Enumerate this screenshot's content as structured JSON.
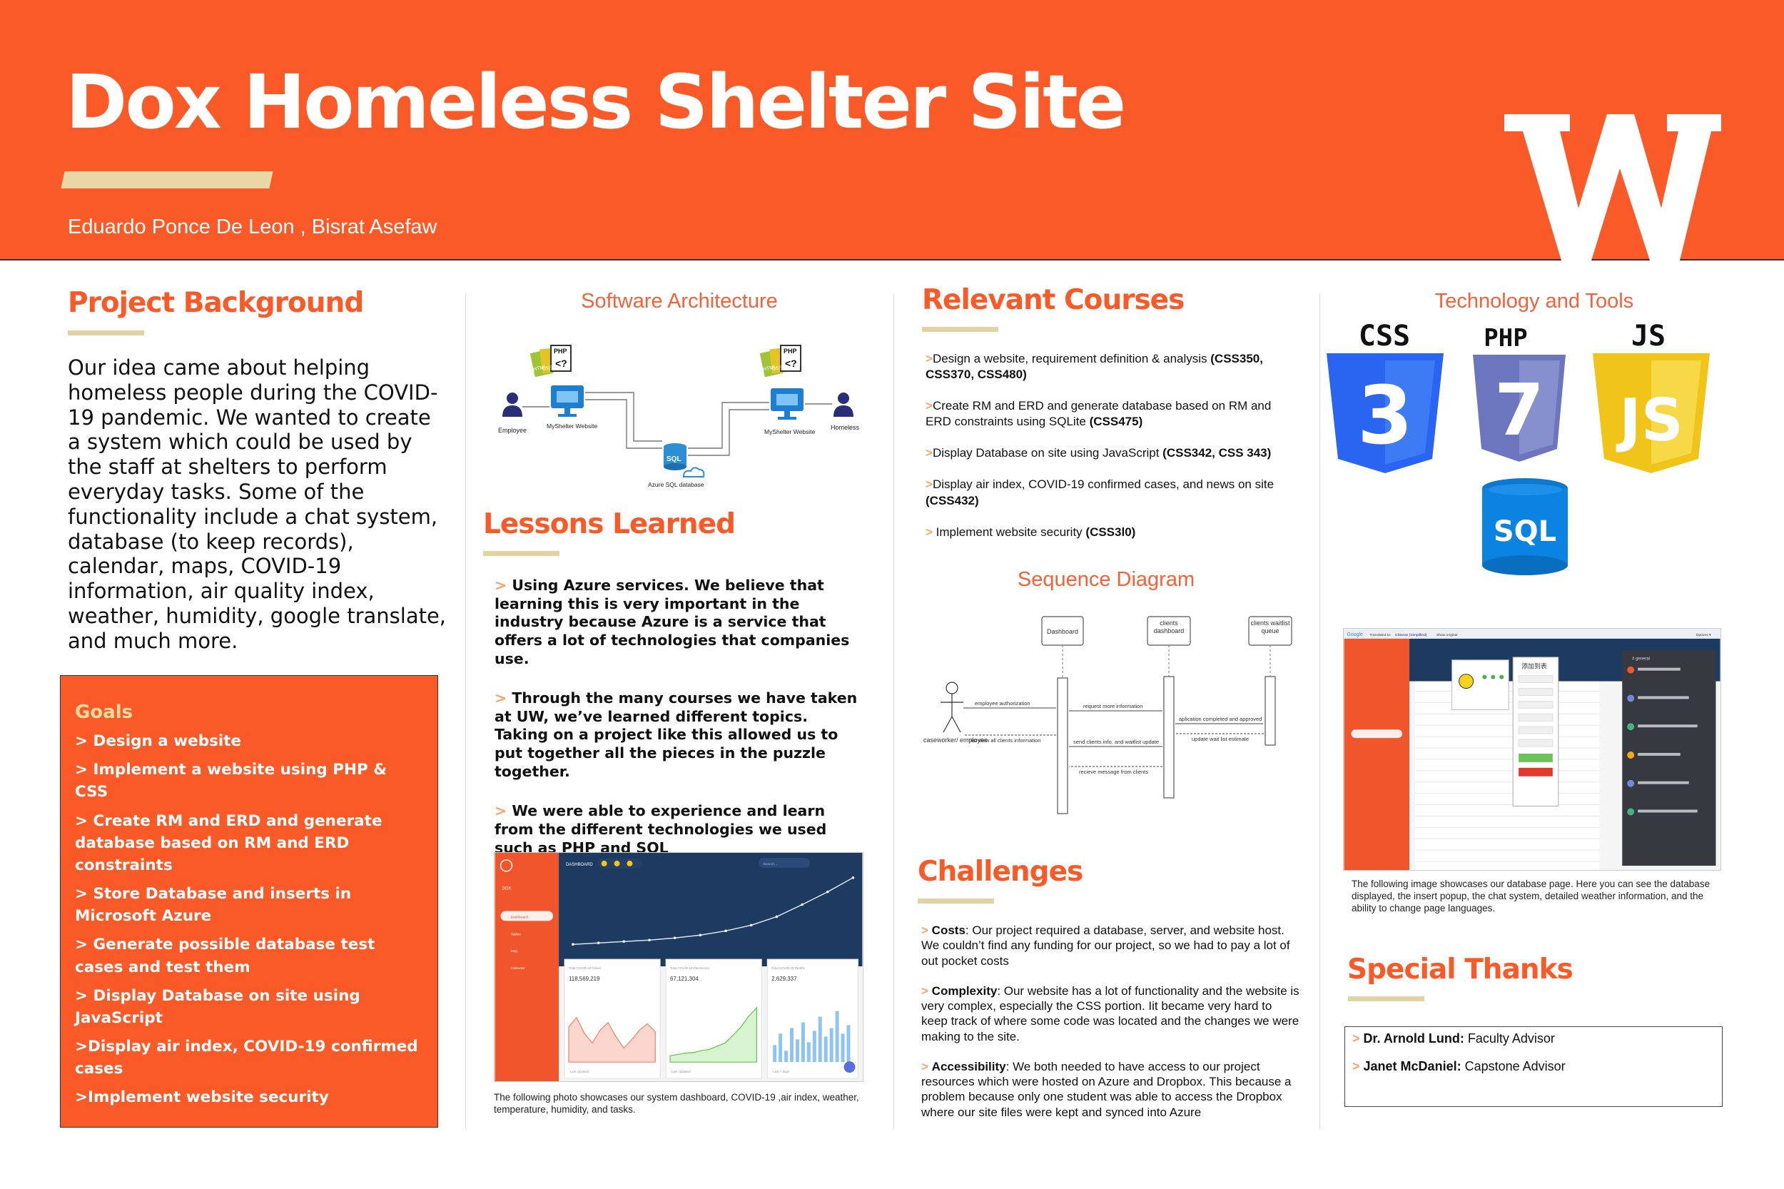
{
  "header": {
    "title": "Dox Homeless Shelter Site",
    "authors": "Eduardo Ponce De Leon , Bisrat Asefaw",
    "logo_letter": "W",
    "bg_color": "#fa5a28",
    "accent_color": "#e9d7a6"
  },
  "background": {
    "title": "Project Background",
    "text": "Our idea came about helping homeless people during the COVID-19 pandemic. We wanted to create a system which could be used by the staff at shelters to perform everyday tasks. Some of the functionality include a chat system, database (to keep records), calendar, maps, COVID-19 information, air quality index, weather, humidity, google translate, and much more."
  },
  "goals": {
    "title": "Goals",
    "items": [
      "> Design a website",
      "> Implement a website using PHP & CSS",
      "> Create RM and ERD and generate database based on RM and ERD constraints",
      "> Store Database and inserts in Microsoft Azure",
      "> Generate possible database test cases and test them",
      "> Display Database on site using JavaScript",
      ">Display air index, COVID-19 confirmed cases",
      ">Implement website security"
    ]
  },
  "architecture": {
    "title": "Software Architecture",
    "file_label": "PHP",
    "file_sub_labels": [
      "HTML",
      "CSS"
    ],
    "file_symbol": "<?",
    "employee": "Employee",
    "site_left": "MyShelter Website",
    "site_right": "MyShelter Website",
    "homeless": "Homeless",
    "db_icon": "SQL",
    "db": "Azure SQL database"
  },
  "lessons": {
    "title": "Lessons Learned",
    "marker": ">",
    "items": [
      "Using Azure services. We believe that learning this is very important in the industry because Azure is a service that offers a lot of technologies that companies use.",
      "Through the many courses we have taken at UW, we’ve learned different topics. Taking on a project like this allowed us to put together all the pieces in the puzzle together.",
      "We were able to experience and learn from the different technologies we used such as PHP and SQL"
    ]
  },
  "dashboard": {
    "caption": "The following photo showcases our system dashboard, COVID-19 ,air index, weather, temperature, humidity, and tasks.",
    "header_label": "DASHBOARD",
    "search_placeholder": "Search...",
    "brand_label": "DOX",
    "nav_items": [
      "Dashboard",
      "Tables",
      "Map",
      "Calendar"
    ],
    "stat_labels": [
      "Total COVID-19 Cases",
      "Total COVID-19 Recoveries",
      "Total COVID-19 Deaths"
    ],
    "stats": [
      "118,569,219",
      "67,121,304",
      "2,629,337"
    ],
    "card_footers": [
      "Last Updated",
      "Last Updated",
      "Last 7 days"
    ],
    "chart_line": [
      0.06,
      0.08,
      0.1,
      0.12,
      0.15,
      0.19,
      0.25,
      0.33,
      0.45,
      0.62,
      0.8,
      1.0
    ],
    "card_red": [
      0.55,
      0.7,
      0.45,
      0.3,
      0.5,
      0.62,
      0.4,
      0.22,
      0.35,
      0.5,
      0.6,
      0.48
    ],
    "card_green": [
      0.1,
      0.12,
      0.14,
      0.15,
      0.18,
      0.2,
      0.25,
      0.3,
      0.42,
      0.55,
      0.72,
      0.85
    ],
    "card_bars": [
      0.3,
      0.5,
      0.2,
      0.6,
      0.4,
      0.7,
      0.35,
      0.55,
      0.8,
      0.45,
      0.6,
      0.9,
      0.5,
      0.65
    ]
  },
  "courses": {
    "title": "Relevant Courses",
    "marker": ">",
    "items": [
      {
        "text": "Design a website, requirement definition & analysis ",
        "code": "(CSS350, CSS370, CSS480)"
      },
      {
        "text": "Create RM and ERD and generate database based on RM and ERD constraints using SQLite ",
        "code": "(CSS475)"
      },
      {
        "text": "Display Database on site using JavaScript ",
        "code": "(CSS342, CSS 343)"
      },
      {
        "text": "Display air index, COVID-19 confirmed cases, and news on site ",
        "code": "(CSS432)"
      },
      {
        "text": " Implement website security ",
        "code": "(CSS3l0)"
      }
    ]
  },
  "sequence": {
    "title": "Sequence Diagram",
    "lifelines": [
      "Dashboard",
      "clients dashboard",
      "clients waitlist queue"
    ],
    "actor": "caseworker/ employee",
    "messages": [
      "employee authorization",
      "request more information",
      "aplication completed and approved",
      "list view all clients information",
      "update wait list estimate",
      "send clients info. and waitlist update",
      "recieve message from clients"
    ]
  },
  "challenges": {
    "title": "Challenges",
    "marker": ">",
    "items": [
      {
        "label": "Costs",
        "text": ": Our project required a database, server, and website host. We couldn’t find any funding for our project, so we had to pay a lot of out pocket costs"
      },
      {
        "label": "Complexity",
        "text": ": Our website has a lot of functionality and the website is very complex, especially the CSS portion. Iit became very hard to keep track of where some code was located and the changes we were making to the site."
      },
      {
        "label": "Accessibility",
        "text": ": We both needed to have access to our project resources which were hosted on Azure and Dropbox. This because a problem because only one student was able to access the Dropbox where our site files were kept and synced into Azure"
      }
    ]
  },
  "tech": {
    "title": "Technology and Tools",
    "labels": [
      "CSS",
      "PHP",
      "JS"
    ],
    "numbers": [
      "3",
      "7",
      "JS"
    ],
    "sql": "SQL"
  },
  "db_page": {
    "caption": "The following image showcases our database page. Here you can see the database displayed, the insert popup, the chat system, detailed weather information, and the ability to change page languages.",
    "google_label": "Google",
    "translated_to": "Translated to:",
    "language": "Chinese (Simplified)",
    "show_original": "Show original",
    "options": "Options ▾",
    "popup_title": "添加到表",
    "channel": "# general"
  },
  "thanks": {
    "title": "Special Thanks",
    "marker": ">",
    "items": [
      {
        "name": "Dr. Arnold Lund:",
        "role": " Faculty Advisor"
      },
      {
        "name": "Janet McDaniel:",
        "role": " Capstone Advisor"
      }
    ]
  }
}
